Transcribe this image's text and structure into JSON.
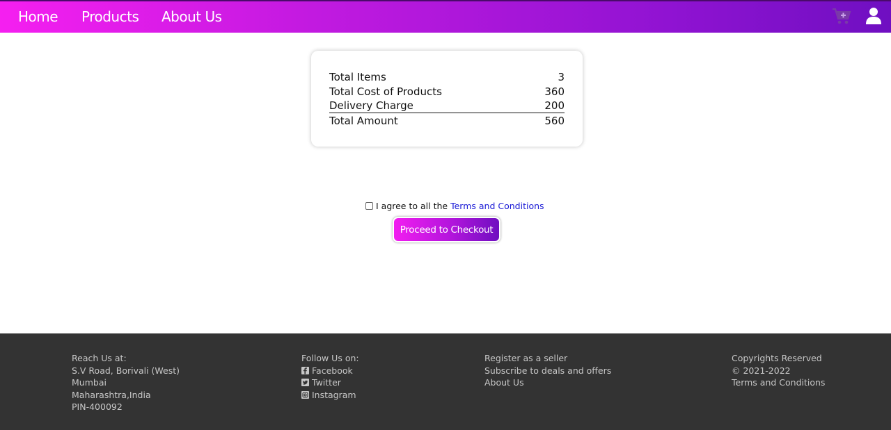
{
  "nav": {
    "home": "Home",
    "products": "Products",
    "about": "About Us",
    "icons": [
      "cart-plus-icon",
      "user-icon"
    ]
  },
  "summary": {
    "rows": [
      {
        "label": "Total Items",
        "value": "3"
      },
      {
        "label": "Total Cost of Products",
        "value": "360"
      },
      {
        "label": "Delivery Charge",
        "value": "200"
      },
      {
        "label": "Total Amount",
        "value": "560"
      }
    ]
  },
  "agree": {
    "text": "I agree to all the",
    "link": "Terms and Conditions",
    "checked": false
  },
  "checkout": {
    "label": "Proceed to Checkout"
  },
  "footer": {
    "reach": {
      "heading": "Reach Us at:",
      "lines": [
        "S.V Road, Borivali (West)",
        "Mumbai",
        "Maharashtra,India",
        "PIN-400092"
      ]
    },
    "follow": {
      "heading": "Follow Us on:",
      "links": [
        {
          "label": "Facebook",
          "icon": "facebook-icon"
        },
        {
          "label": "Twitter",
          "icon": "twitter-icon"
        },
        {
          "label": "Instagram",
          "icon": "instagram-icon"
        }
      ]
    },
    "links": [
      "Register as a seller",
      "Subscribe to deals and offers",
      "About Us"
    ],
    "copyright": [
      "Copyrights Reserved",
      "© 2021-2022",
      "Terms and Conditions"
    ]
  },
  "colors": {
    "nav_gradient_start": "#f51ff0",
    "nav_gradient_end": "#6f0fc1",
    "link_blue": "#1a1ad6",
    "footer_bg": "#333333",
    "footer_text": "#c8c8c8"
  }
}
